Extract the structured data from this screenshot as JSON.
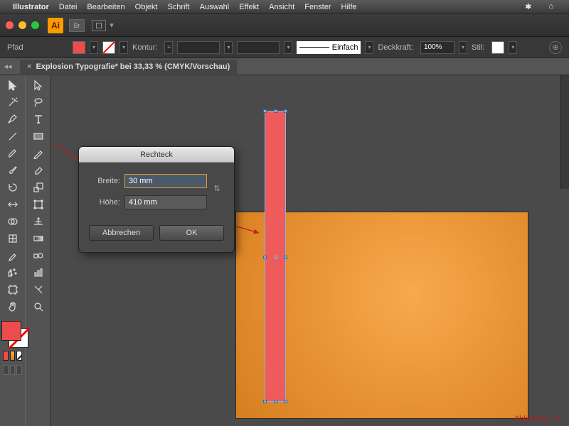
{
  "menubar": {
    "app": "Illustrator",
    "items": [
      "Datei",
      "Bearbeiten",
      "Objekt",
      "Schrift",
      "Auswahl",
      "Effekt",
      "Ansicht",
      "Fenster",
      "Hilfe"
    ]
  },
  "titlebar": {
    "ai": "Ai",
    "br": "Br"
  },
  "control": {
    "selection": "Pfad",
    "kontur_label": "Kontur:",
    "stroke_style": "Einfach",
    "deckkraft_label": "Deckkraft:",
    "deckkraft_value": "100%",
    "stil_label": "Stil:"
  },
  "tab": {
    "title": "Explosion Typografie* bei 33,33 % (CMYK/Vorschau)"
  },
  "dialog": {
    "title": "Rechteck",
    "breite_label": "Breite:",
    "breite_value": "30 mm",
    "hoehe_label": "Höhe:",
    "hoehe_value": "410 mm",
    "cancel": "Abbrechen",
    "ok": "OK"
  },
  "colors": {
    "fill": "#ed4c4c",
    "artboard1": "#f8a94c",
    "artboard2": "#d67e1f",
    "rect": "#ef5b5b"
  },
  "caption": "Abbildung_07"
}
